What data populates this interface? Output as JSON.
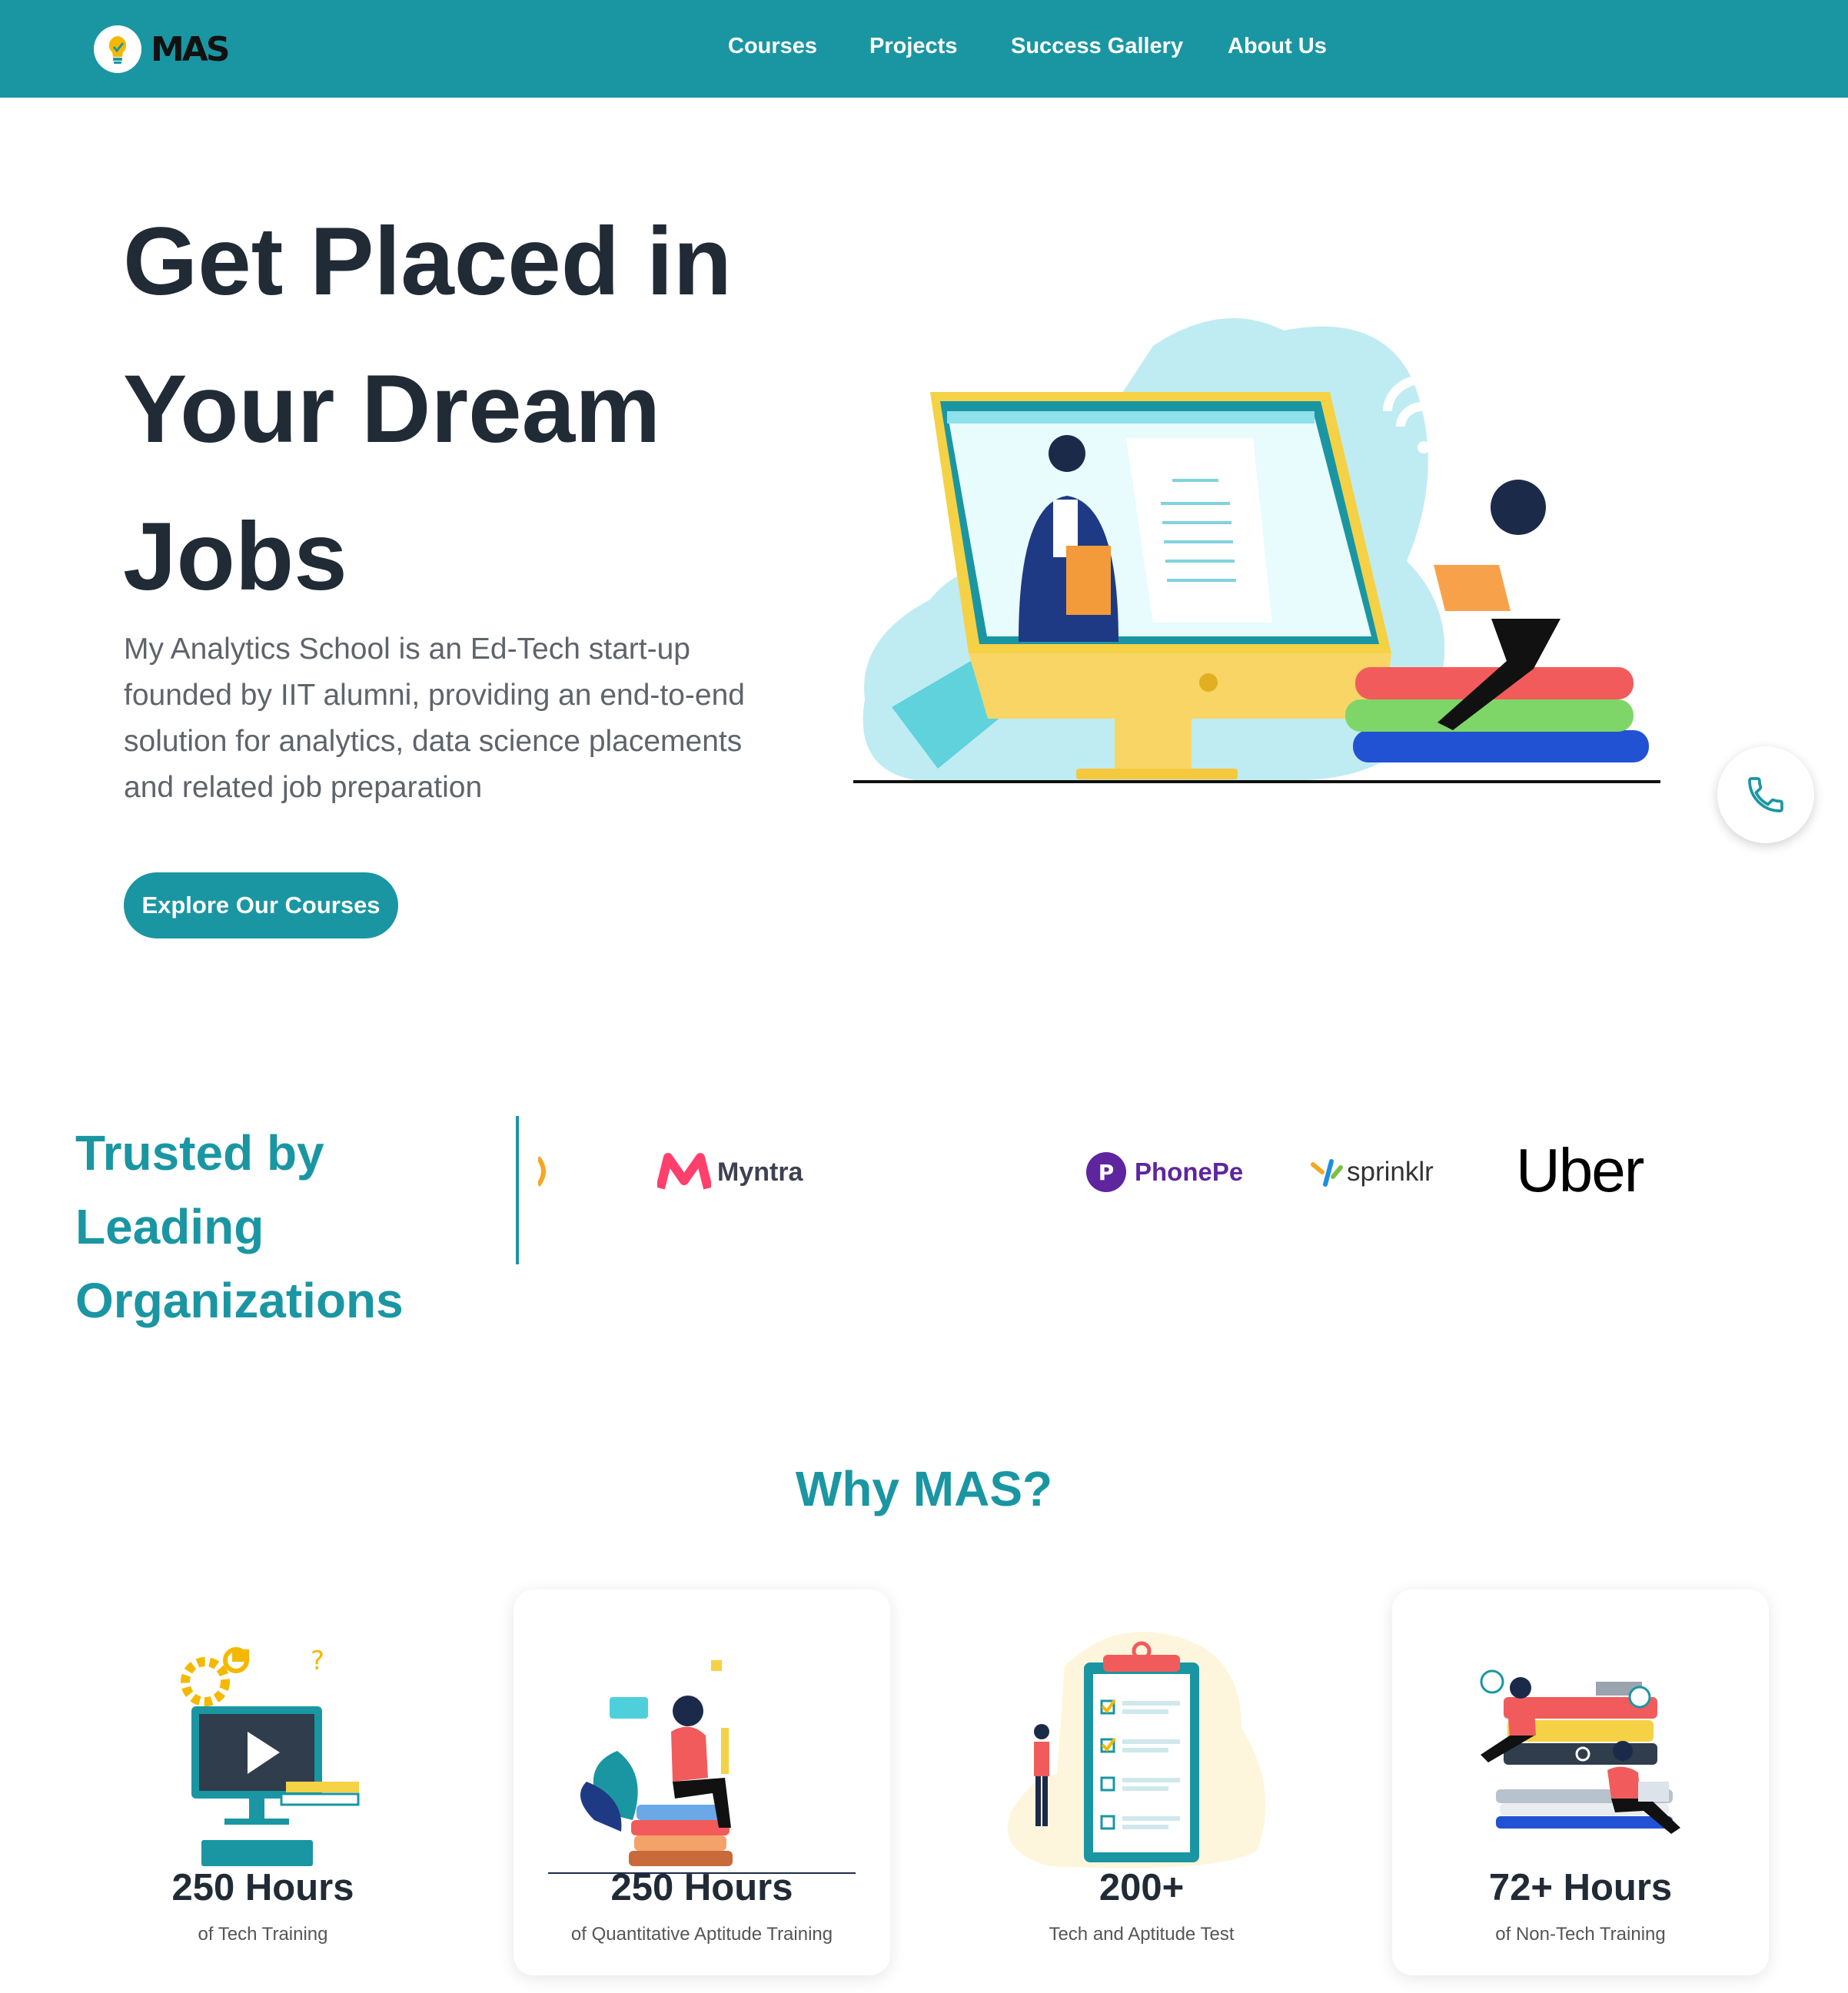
{
  "brand": {
    "logo_text": "MAS"
  },
  "nav": {
    "items": [
      {
        "label": "Courses"
      },
      {
        "label": "Projects"
      },
      {
        "label": "Success Gallery"
      },
      {
        "label": "About Us"
      }
    ]
  },
  "hero": {
    "title_lines": [
      "Get Placed in",
      "Your Dream",
      "Jobs"
    ],
    "description": "My Analytics School is an Ed-Tech start-up founded by IIT alumni, providing an end-to-end solution for analytics, data science placements and related job preparation",
    "cta_label": "Explore Our Courses"
  },
  "trusted": {
    "title_lines": [
      "Trusted by Leading",
      "Organizations"
    ],
    "logos": [
      {
        "name": "Myntra"
      },
      {
        "name": "PhonePe"
      },
      {
        "name": "sprinklr"
      },
      {
        "name": "Uber"
      }
    ]
  },
  "why": {
    "title": "Why MAS?",
    "cards": [
      {
        "value": "250 Hours",
        "label": "of Tech Training"
      },
      {
        "value": "250 Hours",
        "label": "of Quantitative Aptitude Training"
      },
      {
        "value": "200+",
        "label": "Tech and Aptitude Test"
      },
      {
        "value": "72+ Hours",
        "label": "of Non-Tech Training"
      }
    ]
  },
  "colors": {
    "primary": "#1a96a3",
    "heading": "#212b36",
    "body_text": "#5f646b"
  },
  "icons": {
    "phone": "phone-icon",
    "logo": "lightbulb-icon"
  }
}
